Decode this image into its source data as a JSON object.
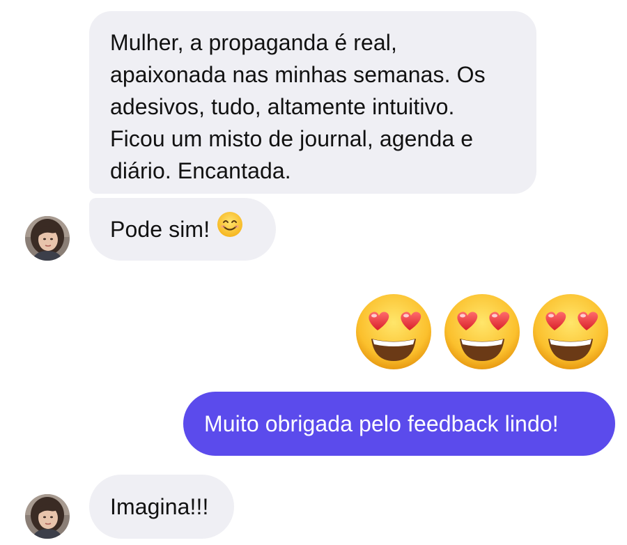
{
  "messages": [
    {
      "sender": "contact",
      "lines": [
        "Mulher, a propaganda é real,",
        "apaixonada nas minhas semanas. Os",
        "adesivos, tudo, altamente intuitivo.",
        "Ficou um misto de journal, agenda e",
        "diário. Encantada."
      ]
    },
    {
      "sender": "contact",
      "text": "Pode sim!",
      "emoji": "smiling-face-icon"
    },
    {
      "sender": "me",
      "emojis": [
        "heart-eyes-icon",
        "heart-eyes-icon",
        "heart-eyes-icon"
      ]
    },
    {
      "sender": "me",
      "text": "Muito obrigada pelo feedback lindo!"
    },
    {
      "sender": "contact",
      "text": "Imagina!!!"
    }
  ],
  "colors": {
    "incoming_bubble": "#efeff4",
    "outgoing_bubble": "#5b4bec",
    "outgoing_text": "#ffffff",
    "incoming_text": "#111111"
  }
}
